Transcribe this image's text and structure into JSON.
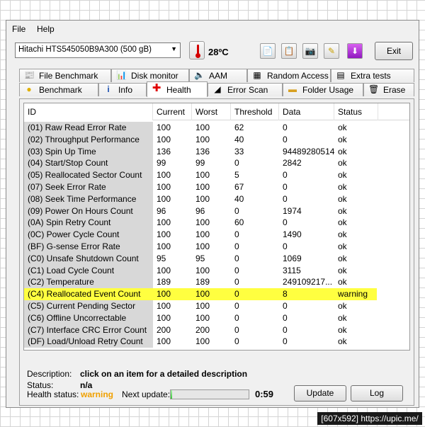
{
  "menu": {
    "file": "File",
    "help": "Help"
  },
  "toolbar": {
    "drive": "Hitachi HTS545050B9A300 (500 gB)",
    "temperature": "28ºC",
    "exit": "Exit"
  },
  "tabs_top": [
    "File Benchmark",
    "Disk monitor",
    "AAM",
    "Random Access",
    "Extra tests"
  ],
  "tabs_bottom": [
    "Benchmark",
    "Info",
    "Health",
    "Error Scan",
    "Folder Usage",
    "Erase"
  ],
  "active_tab": "Health",
  "table": {
    "headers": [
      "ID",
      "Current",
      "Worst",
      "Threshold",
      "Data",
      "Status"
    ],
    "rows": [
      [
        "(01) Raw Read Error Rate",
        "100",
        "100",
        "62",
        "0",
        "ok"
      ],
      [
        "(02) Throughput Performance",
        "100",
        "100",
        "40",
        "0",
        "ok"
      ],
      [
        "(03) Spin Up Time",
        "136",
        "136",
        "33",
        "94489280514",
        "ok"
      ],
      [
        "(04) Start/Stop Count",
        "99",
        "99",
        "0",
        "2842",
        "ok"
      ],
      [
        "(05) Reallocated Sector Count",
        "100",
        "100",
        "5",
        "0",
        "ok"
      ],
      [
        "(07) Seek Error Rate",
        "100",
        "100",
        "67",
        "0",
        "ok"
      ],
      [
        "(08) Seek Time Performance",
        "100",
        "100",
        "40",
        "0",
        "ok"
      ],
      [
        "(09) Power On Hours Count",
        "96",
        "96",
        "0",
        "1974",
        "ok"
      ],
      [
        "(0A) Spin Retry Count",
        "100",
        "100",
        "60",
        "0",
        "ok"
      ],
      [
        "(0C) Power Cycle Count",
        "100",
        "100",
        "0",
        "1490",
        "ok"
      ],
      [
        "(BF) G-sense Error Rate",
        "100",
        "100",
        "0",
        "0",
        "ok"
      ],
      [
        "(C0) Unsafe Shutdown Count",
        "95",
        "95",
        "0",
        "1069",
        "ok"
      ],
      [
        "(C1) Load Cycle Count",
        "100",
        "100",
        "0",
        "3115",
        "ok"
      ],
      [
        "(C2) Temperature",
        "189",
        "189",
        "0",
        "249109217...",
        "ok"
      ],
      [
        "(C4) Reallocated Event Count",
        "100",
        "100",
        "0",
        "8",
        "warning"
      ],
      [
        "(C5) Current Pending Sector",
        "100",
        "100",
        "0",
        "0",
        "ok"
      ],
      [
        "(C6) Offline Uncorrectable",
        "100",
        "100",
        "0",
        "0",
        "ok"
      ],
      [
        "(C7) Interface CRC Error Count",
        "200",
        "200",
        "0",
        "0",
        "ok"
      ],
      [
        "(DF) Load/Unload Retry Count",
        "100",
        "100",
        "0",
        "0",
        "ok"
      ]
    ],
    "highlight_row": 14
  },
  "details": {
    "description_label": "Description:",
    "description_value": "click on an item for a detailed description",
    "status_label": "Status:",
    "status_value": "n/a"
  },
  "footer": {
    "health_label": "Health status:",
    "health_value": "warning",
    "health_color": "#f0a000",
    "next_update_label": "Next update:",
    "progress_fraction": 0.02,
    "next_update_time": "0:59",
    "update_button": "Update",
    "log_button": "Log"
  },
  "watermark": "[607x592] https://upic.me/"
}
